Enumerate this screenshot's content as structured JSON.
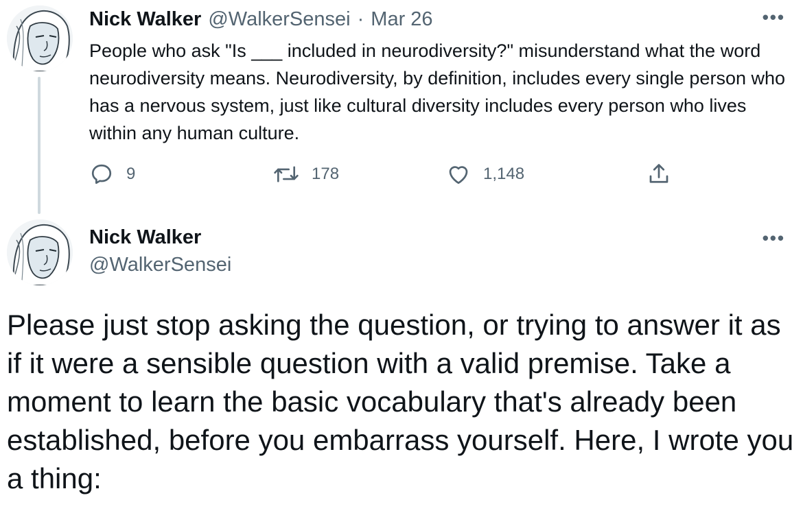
{
  "tweet1": {
    "author_name": "Nick Walker",
    "handle": "@WalkerSensei",
    "separator": "·",
    "date": "Mar 26",
    "more": "•••",
    "text": "People who ask \"Is ___ included in neurodiversity?\" misunderstand what the word neurodiversity means. Neurodiversity, by definition, includes every single person who has a nervous system, just like cultural diversity includes every person who lives within any human culture.",
    "replies": "9",
    "retweets": "178",
    "likes": "1,148"
  },
  "tweet2": {
    "author_name": "Nick Walker",
    "handle": "@WalkerSensei",
    "more": "•••",
    "text": "Please just stop asking the question, or trying to answer it as if it were a sensible question with a valid premise. Take a moment to learn the basic vocabulary that's already been established, before you embarrass yourself. Here, I wrote you a thing:"
  },
  "icons": {
    "reply": "reply-icon",
    "retweet": "retweet-icon",
    "like": "like-icon",
    "share": "share-icon",
    "avatar": "portrait-avatar"
  }
}
